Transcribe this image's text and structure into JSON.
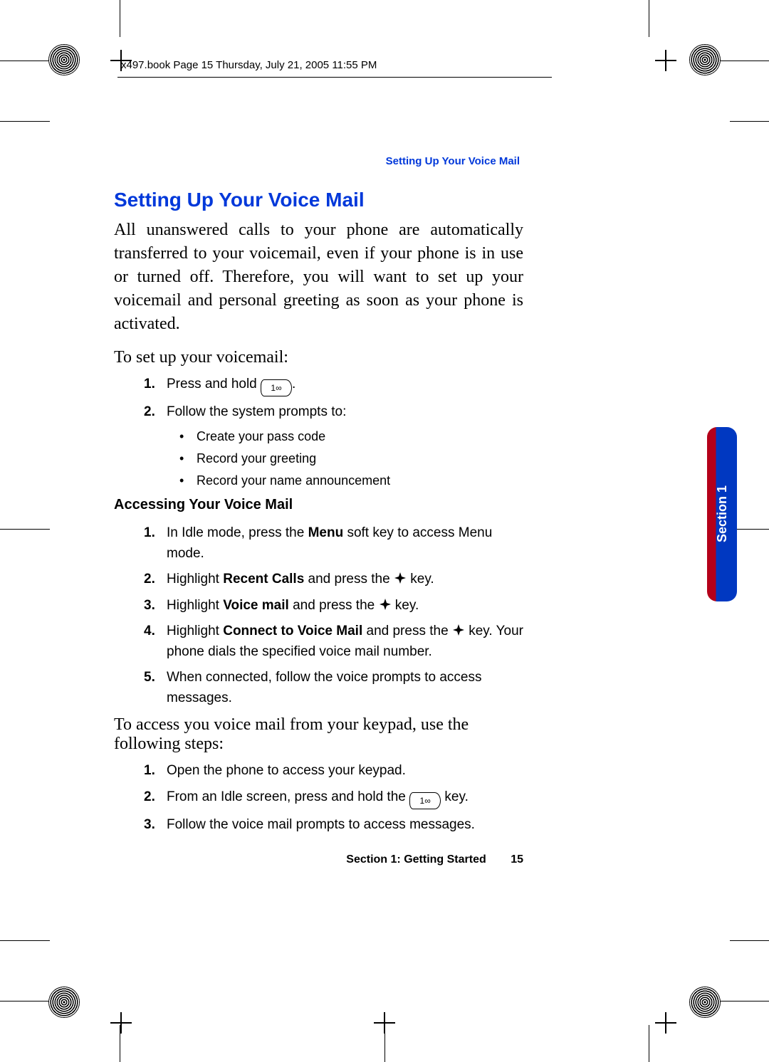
{
  "meta_header": "x497.book  Page 15  Thursday, July 21, 2005  11:55 PM",
  "breadcrumb": "Setting Up Your Voice Mail",
  "section_tab": "Section 1",
  "h1": "Setting Up Your Voice Mail",
  "intro": "All unanswered calls to your phone are automatically transferred to your voicemail, even if your phone is in use or turned off. Therefore, you will want to set up your voicemail and personal greeting as soon as your phone is activated.",
  "lead1": "To set up your voicemail:",
  "setup_steps": {
    "s1_prefix": "Press and hold ",
    "s1_suffix": ".",
    "s2": "Follow the system prompts to:"
  },
  "setup_bullets": [
    "Create your pass code",
    "Record your greeting",
    "Record your name announcement"
  ],
  "h2": "Accessing Your Voice Mail",
  "access_steps": {
    "a1_prefix": "In Idle mode, press the ",
    "a1_bold": "Menu",
    "a1_suffix": " soft key to access Menu mode.",
    "a2_prefix": "Highlight ",
    "a2_bold": "Recent Calls",
    "a2_mid": " and press the ",
    "a2_suffix": " key.",
    "a3_prefix": "Highlight ",
    "a3_bold": "Voice mail",
    "a3_mid": " and press the ",
    "a3_suffix": " key.",
    "a4_prefix": "Highlight ",
    "a4_bold": "Connect to Voice Mail",
    "a4_mid": " and press the ",
    "a4_suffix": " key. Your phone dials the specified voice mail number.",
    "a5": "When connected, follow the voice prompts to access messages."
  },
  "lead2": "To access you voice mail from your keypad, use the following steps:",
  "keypad_steps": {
    "k1": "Open the phone to access your keypad.",
    "k2_prefix": "From an Idle screen, press and hold the ",
    "k2_suffix": " key.",
    "k3": "Follow the voice mail prompts to access messages."
  },
  "footer_section": "Section 1: Getting Started",
  "footer_page": "15",
  "icons": {
    "key1_label": "1∞",
    "nav_key": "nav-key"
  }
}
